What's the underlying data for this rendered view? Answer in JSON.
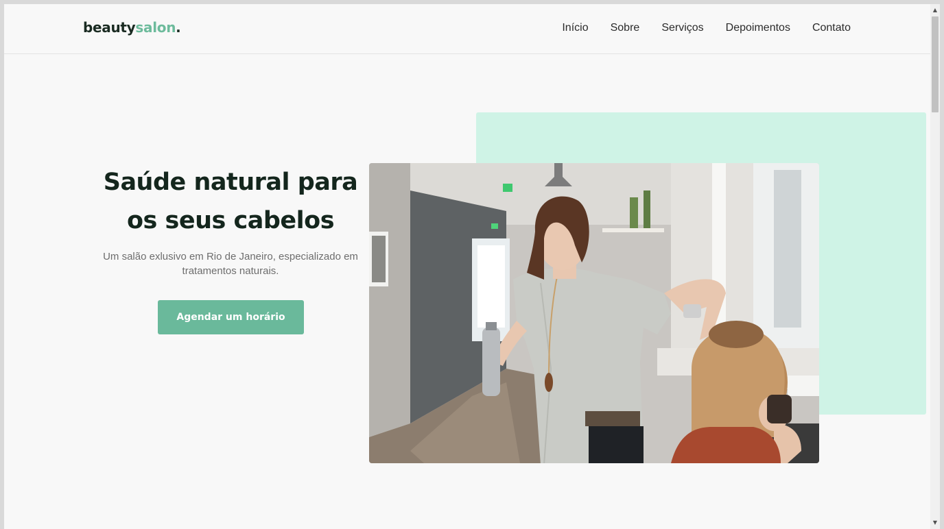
{
  "header": {
    "logo": {
      "text": "beauty",
      "accent": "salon",
      "dot": "."
    },
    "nav": [
      {
        "label": "Início"
      },
      {
        "label": "Sobre"
      },
      {
        "label": "Serviços"
      },
      {
        "label": "Depoimentos"
      },
      {
        "label": "Contato"
      }
    ]
  },
  "hero": {
    "title": "Saúde natural para os seus cabelos",
    "subtitle": "Um salão exlusivo em Rio de Janeiro, especializado em tratamentos naturais.",
    "cta_label": "Agendar um horário",
    "image_subject": "hairdresser-styling-client-photo"
  },
  "colors": {
    "accent": "#6ab99b",
    "mint_block": "#cff3e6",
    "heading": "#14261d",
    "page_background": "#f8f8f8"
  }
}
